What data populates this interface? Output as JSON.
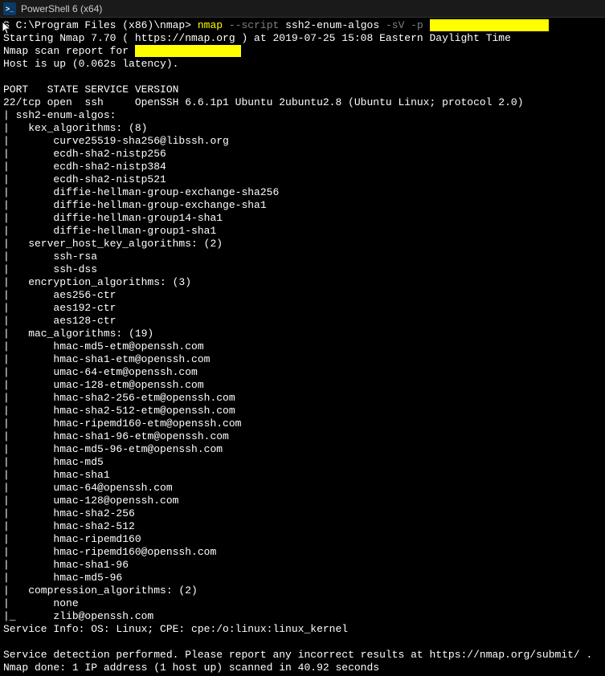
{
  "window": {
    "title": "PowerShell 6 (x64)"
  },
  "prompt": {
    "path": "S C:\\Program Files (x86)\\nmap>",
    "cmd": "nmap",
    "flags1": "--script",
    "script": "ssh2-enum-algos",
    "flags2": "-sV -p",
    "redacted_target": "                   "
  },
  "out": {
    "start_prefix": "Starting Nmap 7.70 ( ",
    "start_url": "https://nmap.org",
    "start_suffix": " ) at 2019-07-25 15:08 Eastern Daylight Time",
    "scanreport": "Nmap scan report for ",
    "redacted_host": "                 ",
    "hostup": "Host is up (0.062s latency).",
    "header": "PORT   STATE SERVICE VERSION",
    "portline": "22/tcp open  ssh     OpenSSH 6.6.1p1 Ubuntu 2ubuntu2.8 (Ubuntu Linux; protocol 2.0)",
    "algroot": "| ssh2-enum-algos:",
    "kex_hdr": "|   kex_algorithms: (8)",
    "kex": [
      "|       curve25519-sha256@libssh.org",
      "|       ecdh-sha2-nistp256",
      "|       ecdh-sha2-nistp384",
      "|       ecdh-sha2-nistp521",
      "|       diffie-hellman-group-exchange-sha256",
      "|       diffie-hellman-group-exchange-sha1",
      "|       diffie-hellman-group14-sha1",
      "|       diffie-hellman-group1-sha1"
    ],
    "hostkey_hdr": "|   server_host_key_algorithms: (2)",
    "hostkey": [
      "|       ssh-rsa",
      "|       ssh-dss"
    ],
    "enc_hdr": "|   encryption_algorithms: (3)",
    "enc": [
      "|       aes256-ctr",
      "|       aes192-ctr",
      "|       aes128-ctr"
    ],
    "mac_hdr": "|   mac_algorithms: (19)",
    "mac": [
      "|       hmac-md5-etm@openssh.com",
      "|       hmac-sha1-etm@openssh.com",
      "|       umac-64-etm@openssh.com",
      "|       umac-128-etm@openssh.com",
      "|       hmac-sha2-256-etm@openssh.com",
      "|       hmac-sha2-512-etm@openssh.com",
      "|       hmac-ripemd160-etm@openssh.com",
      "|       hmac-sha1-96-etm@openssh.com",
      "|       hmac-md5-96-etm@openssh.com",
      "|       hmac-md5",
      "|       hmac-sha1",
      "|       umac-64@openssh.com",
      "|       umac-128@openssh.com",
      "|       hmac-sha2-256",
      "|       hmac-sha2-512",
      "|       hmac-ripemd160",
      "|       hmac-ripemd160@openssh.com",
      "|       hmac-sha1-96",
      "|       hmac-md5-96"
    ],
    "comp_hdr": "|   compression_algorithms: (2)",
    "comp": [
      "|       none",
      "|_      zlib@openssh.com"
    ],
    "svcinfo": "Service Info: OS: Linux; CPE: cpe:/o:linux:linux_kernel",
    "detect": "Service detection performed. Please report any incorrect results at https://nmap.org/submit/ .",
    "done": "Nmap done: 1 IP address (1 host up) scanned in 40.92 seconds"
  }
}
